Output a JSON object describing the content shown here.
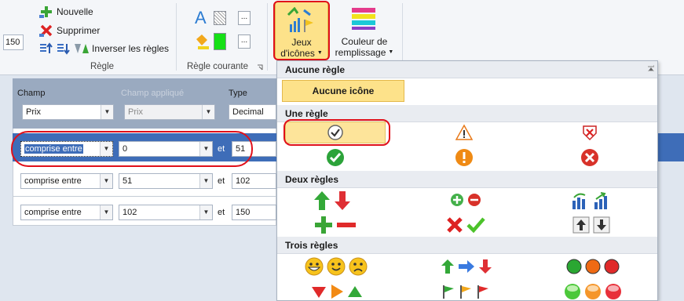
{
  "ribbon": {
    "zoom_value": "150",
    "rule_group": {
      "new_label": "Nouvelle",
      "delete_label": "Supprimer",
      "invert_label": "Inverser les règles",
      "group_label": "Règle"
    },
    "current_rule_group": {
      "group_label": "Règle courante",
      "more_label": "..."
    },
    "icon_sets_button": {
      "line1": "Jeux",
      "line2": "d'icônes"
    },
    "fill_color_button": {
      "line1": "Couleur de",
      "line2": "remplissage"
    }
  },
  "form": {
    "headers": {
      "field": "Champ",
      "applied_field": "Champ appliqué",
      "type": "Type"
    },
    "field_value": "Prix",
    "applied_field_value": "Prix",
    "type_value": "Decimal",
    "and_label": "et",
    "rows": [
      {
        "operator": "comprise entre",
        "from": "0",
        "to": "51"
      },
      {
        "operator": "comprise entre",
        "from": "51",
        "to": "102"
      },
      {
        "operator": "comprise entre",
        "from": "102",
        "to": "150"
      }
    ]
  },
  "menu": {
    "sections": {
      "none": "Aucune règle",
      "one": "Une règle",
      "two": "Deux règles",
      "three": "Trois règles"
    },
    "no_icon_label": "Aucune icône"
  },
  "colors": {
    "selection_blue": "#3e6db8",
    "highlight_yellow": "#fde28a",
    "annotation_red": "#e0101a"
  }
}
